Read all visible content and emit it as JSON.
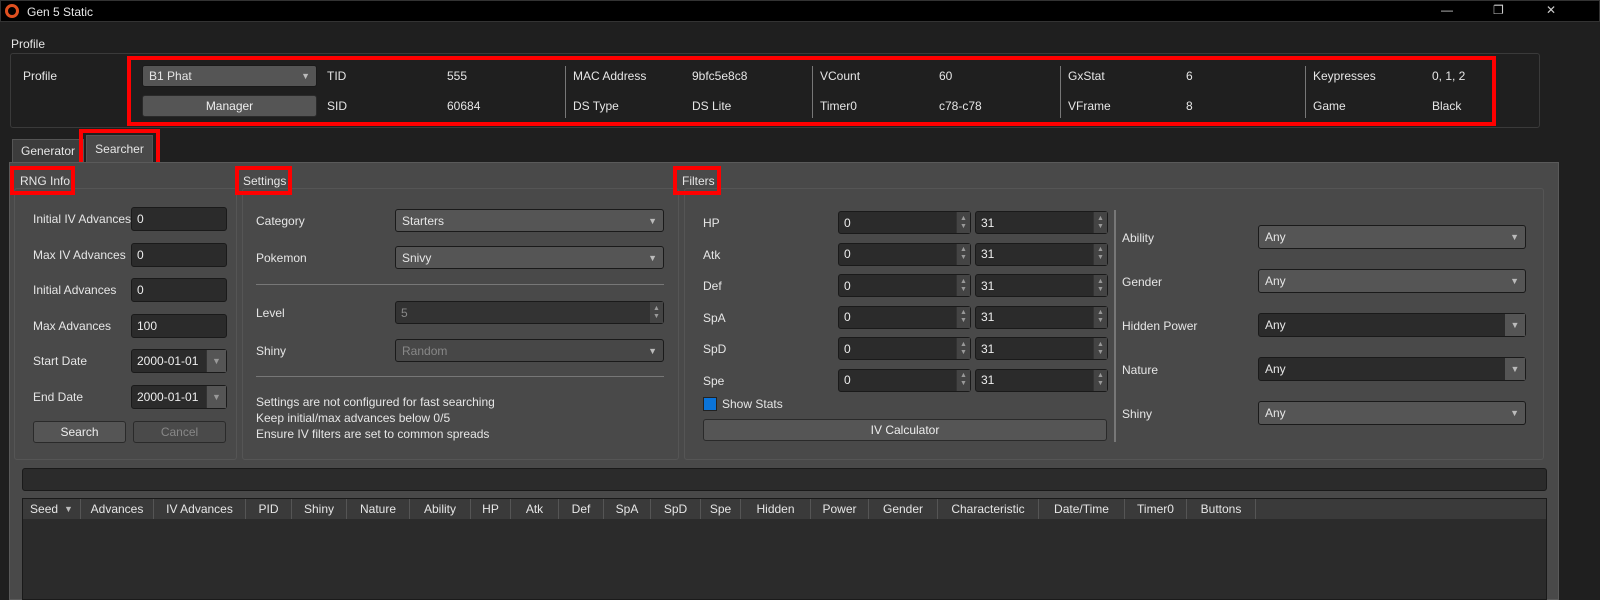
{
  "window": {
    "title": "Gen 5 Static",
    "minimize": "—",
    "restore": "❐",
    "close": "✕"
  },
  "profile_group": {
    "title": "Profile",
    "label": "Profile",
    "selected": "B1 Phat",
    "manager": "Manager",
    "fields": [
      {
        "label": "TID",
        "value": "555"
      },
      {
        "label": "SID",
        "value": "60684"
      },
      {
        "label": "MAC Address",
        "value": "9bfc5e8c8"
      },
      {
        "label": "DS Type",
        "value": "DS Lite"
      },
      {
        "label": "VCount",
        "value": "60"
      },
      {
        "label": "Timer0",
        "value": "c78-c78"
      },
      {
        "label": "GxStat",
        "value": "6"
      },
      {
        "label": "VFrame",
        "value": "8"
      },
      {
        "label": "Keypresses",
        "value": "0, 1, 2"
      },
      {
        "label": "Game",
        "value": "Black"
      }
    ]
  },
  "tabs": [
    {
      "label": "Generator"
    },
    {
      "label": "Searcher",
      "active": true
    }
  ],
  "rng_info": {
    "title": "RNG Info",
    "initial_iv_advances": {
      "label": "Initial IV Advances",
      "value": "0"
    },
    "max_iv_advances": {
      "label": "Max IV Advances",
      "value": "0"
    },
    "initial_advances": {
      "label": "Initial Advances",
      "value": "0"
    },
    "max_advances": {
      "label": "Max Advances",
      "value": "100"
    },
    "start_date": {
      "label": "Start Date",
      "value": "2000-01-01"
    },
    "end_date": {
      "label": "End Date",
      "value": "2000-01-01"
    },
    "search": "Search",
    "cancel": "Cancel"
  },
  "settings": {
    "title": "Settings",
    "category": {
      "label": "Category",
      "value": "Starters"
    },
    "pokemon": {
      "label": "Pokemon",
      "value": "Snivy"
    },
    "level": {
      "label": "Level",
      "value": "5"
    },
    "shiny": {
      "label": "Shiny",
      "value": "Random"
    },
    "warnings": [
      "Settings are not configured for fast searching",
      "Keep initial/max advances below 0/5",
      "Ensure IV filters are set to common spreads"
    ]
  },
  "filters": {
    "title": "Filters",
    "ivs": [
      {
        "label": "HP",
        "min": "0",
        "max": "31"
      },
      {
        "label": "Atk",
        "min": "0",
        "max": "31"
      },
      {
        "label": "Def",
        "min": "0",
        "max": "31"
      },
      {
        "label": "SpA",
        "min": "0",
        "max": "31"
      },
      {
        "label": "SpD",
        "min": "0",
        "max": "31"
      },
      {
        "label": "Spe",
        "min": "0",
        "max": "31"
      }
    ],
    "show_stats": "Show Stats",
    "show_stats_checked": true,
    "iv_calculator": "IV Calculator",
    "selects": [
      {
        "label": "Ability",
        "value": "Any"
      },
      {
        "label": "Gender",
        "value": "Any"
      },
      {
        "label": "Hidden Power",
        "value": "Any"
      },
      {
        "label": "Nature",
        "value": "Any"
      },
      {
        "label": "Shiny",
        "value": "Any"
      }
    ]
  },
  "table": {
    "columns": [
      "Seed",
      "Advances",
      "IV Advances",
      "PID",
      "Shiny",
      "Nature",
      "Ability",
      "HP",
      "Atk",
      "Def",
      "SpA",
      "SpD",
      "Spe",
      "Hidden",
      "Power",
      "Gender",
      "Characteristic",
      "Date/Time",
      "Timer0",
      "Buttons"
    ]
  },
  "colors": {
    "accent": "#0a74da",
    "highlight": "#ff0000"
  }
}
